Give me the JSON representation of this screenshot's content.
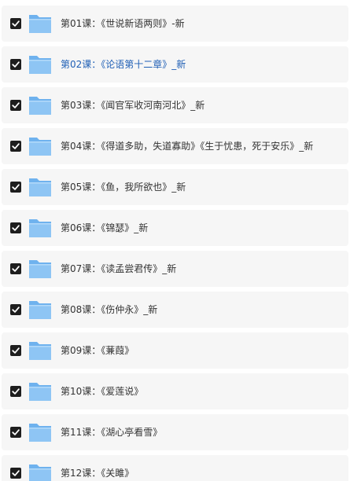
{
  "colors": {
    "row_background": "#f6f6f6",
    "checkbox": "#1e1e1e",
    "text": "#333333",
    "link_text": "#1f5fb5",
    "folder_body": "#8ec5f4",
    "folder_tab": "#6fb2ee"
  },
  "items": [
    {
      "label": "第01课：《世说新语两则》-新",
      "checked": true,
      "icon": "folder-icon",
      "active": false
    },
    {
      "label": "第02课：《论语第十二章》_新",
      "checked": true,
      "icon": "folder-icon",
      "active": true
    },
    {
      "label": "第03课：《闻官军收河南河北》_新",
      "checked": true,
      "icon": "folder-icon",
      "active": false
    },
    {
      "label": "第04课：《得道多助，失道寡助》《生于忧患，死于安乐》_新",
      "checked": true,
      "icon": "folder-icon",
      "active": false
    },
    {
      "label": "第05课：《鱼，我所欲也》_新",
      "checked": true,
      "icon": "folder-icon",
      "active": false
    },
    {
      "label": "第06课：《锦瑟》_新",
      "checked": true,
      "icon": "folder-icon",
      "active": false
    },
    {
      "label": "第07课：《读孟尝君传》_新",
      "checked": true,
      "icon": "folder-icon",
      "active": false
    },
    {
      "label": "第08课：《伤仲永》_新",
      "checked": true,
      "icon": "folder-icon",
      "active": false
    },
    {
      "label": "第09课：《蒹葭》",
      "checked": true,
      "icon": "folder-icon",
      "active": false
    },
    {
      "label": "第10课：《爱莲说》",
      "checked": true,
      "icon": "folder-icon",
      "active": false
    },
    {
      "label": "第11课：《湖心亭看雪》",
      "checked": true,
      "icon": "folder-icon",
      "active": false
    },
    {
      "label": "第12课：《关雎》",
      "checked": true,
      "icon": "folder-icon",
      "active": false
    }
  ]
}
